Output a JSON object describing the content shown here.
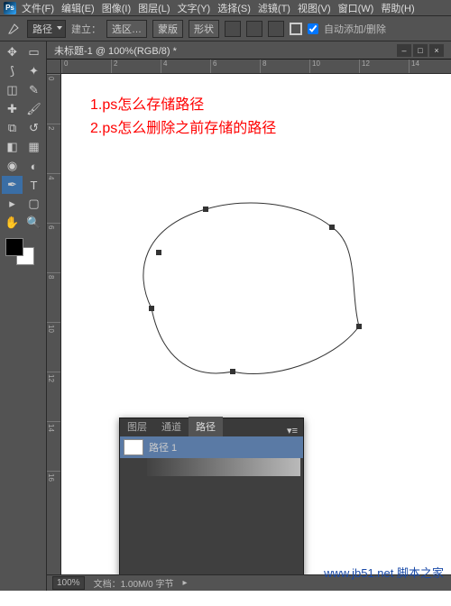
{
  "menubar": {
    "items": [
      "文件(F)",
      "编辑(E)",
      "图像(I)",
      "图层(L)",
      "文字(Y)",
      "选择(S)",
      "滤镜(T)",
      "视图(V)",
      "窗口(W)",
      "帮助(H)"
    ]
  },
  "optbar": {
    "mode": "路径",
    "build": "建立：",
    "b1": "选区…",
    "b2": "蒙版",
    "b3": "形状",
    "auto": "自动添加/删除"
  },
  "doc": {
    "tab_title": "未标题-1 @ 100%(RGB/8) *"
  },
  "ruler_h": [
    "0",
    "2",
    "4",
    "6",
    "8",
    "10",
    "12",
    "14"
  ],
  "ruler_v": [
    "0",
    "2",
    "4",
    "6",
    "8",
    "10",
    "12",
    "14",
    "16"
  ],
  "annot": {
    "l1": "1.ps怎么存储路径",
    "l2": "2.ps怎么删除之前存储的路径"
  },
  "panel": {
    "tabs": [
      "图层",
      "通道",
      "路径"
    ],
    "active_tab": 2,
    "row_label": "路径 1"
  },
  "status": {
    "zoom": "100%",
    "info": "文档：1.00M/0 字节"
  },
  "watermark": "www.jb51.net 脚本之家"
}
